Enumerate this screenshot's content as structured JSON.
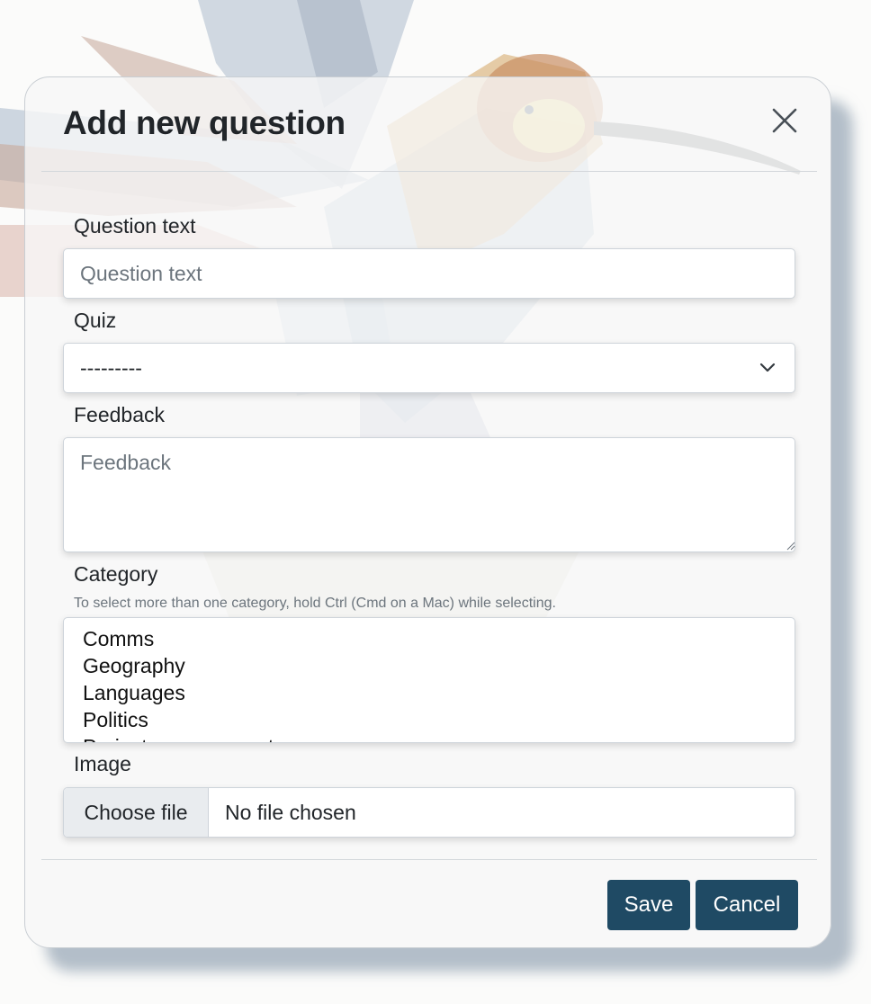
{
  "modal": {
    "title": "Add new question"
  },
  "form": {
    "question_text": {
      "label": "Question text",
      "placeholder": "Question text",
      "value": ""
    },
    "quiz": {
      "label": "Quiz",
      "selected": "---------"
    },
    "feedback": {
      "label": "Feedback",
      "placeholder": "Feedback",
      "value": ""
    },
    "category": {
      "label": "Category",
      "help": "To select more than one category, hold Ctrl (Cmd on a Mac) while selecting.",
      "options": [
        "Comms",
        "Geography",
        "Languages",
        "Politics",
        "Project management"
      ]
    },
    "image": {
      "label": "Image",
      "button_label": "Choose file",
      "status": "No file chosen"
    }
  },
  "footer": {
    "save_label": "Save",
    "cancel_label": "Cancel"
  },
  "colors": {
    "primary_button": "#1f4a64",
    "backdrop_bird": "hummingbird-watercolor"
  },
  "icons": {
    "close": "close-icon",
    "select": "chevron-down-icon"
  }
}
